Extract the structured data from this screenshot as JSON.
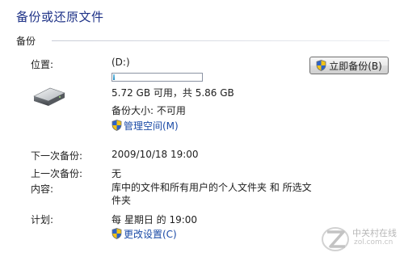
{
  "page": {
    "title": "备份或还原文件"
  },
  "backup": {
    "section_label": "备份",
    "location": {
      "label": "位置:",
      "value": "(D:)"
    },
    "usage": {
      "used_fraction": 0.021,
      "text": "5.72 GB 可用，共 5.86 GB"
    },
    "size": "备份大小: 不可用",
    "manage_space_link": "管理空间(M)",
    "backup_now_button": "立即备份(B)",
    "next_backup": {
      "label": "下一次备份:",
      "value": "2009/10/18 19:00"
    },
    "last_backup": {
      "label": "上一次备份:",
      "value": "无"
    },
    "contents": {
      "label": "内容:",
      "value": "库中的文件和所有用户的个人文件夹 和 所选文件夹"
    },
    "schedule": {
      "label": "计划:",
      "value": "每 星期日 的 19:00"
    },
    "change_settings_link": "更改设置(C)"
  },
  "watermark": {
    "text": "中关村在线",
    "url": "zol.com.cn"
  },
  "colors": {
    "title": "#1e3287",
    "link": "#1a4aa6",
    "meter_fill": "#1d8bc3"
  },
  "icons": {
    "drive": "hard-drive-icon",
    "shield": "uac-shield-icon"
  }
}
